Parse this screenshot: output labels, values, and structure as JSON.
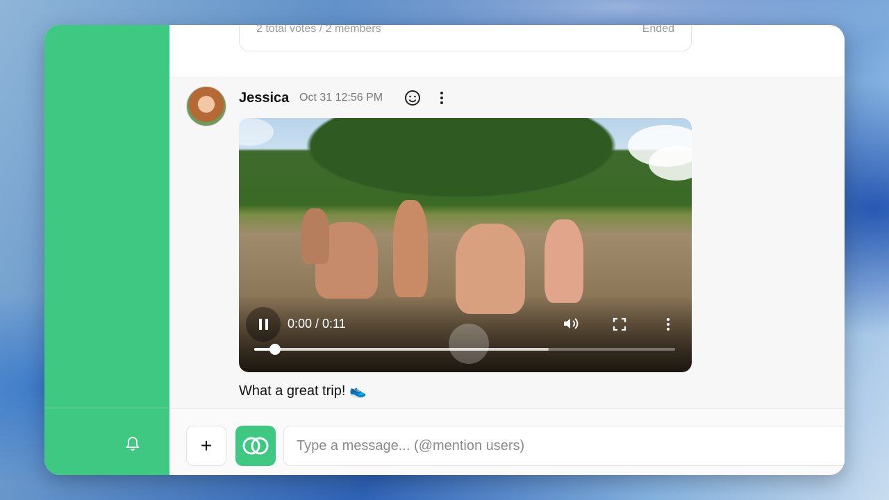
{
  "poll": {
    "votes_text": "2 total votes / 2 members",
    "status": "Ended"
  },
  "message": {
    "author": "Jessica",
    "timestamp": "Oct 31 12:56 PM",
    "caption": "What a great trip! 👟",
    "react_icon": "smiley-icon",
    "more_icon": "more-vertical-icon"
  },
  "video": {
    "time_display": "0:00 / 0:11",
    "played_fraction": 0.05,
    "buffered_fraction": 0.7,
    "icons": [
      "pause-icon",
      "volume-icon",
      "fullscreen-icon",
      "more-vertical-icon"
    ]
  },
  "composer": {
    "add_label": "+",
    "placeholder": "Type a message... (@mention users)",
    "value": ""
  },
  "sidebar": {
    "notification_icon": "bell-icon"
  },
  "colors": {
    "accent": "#3ec882"
  }
}
